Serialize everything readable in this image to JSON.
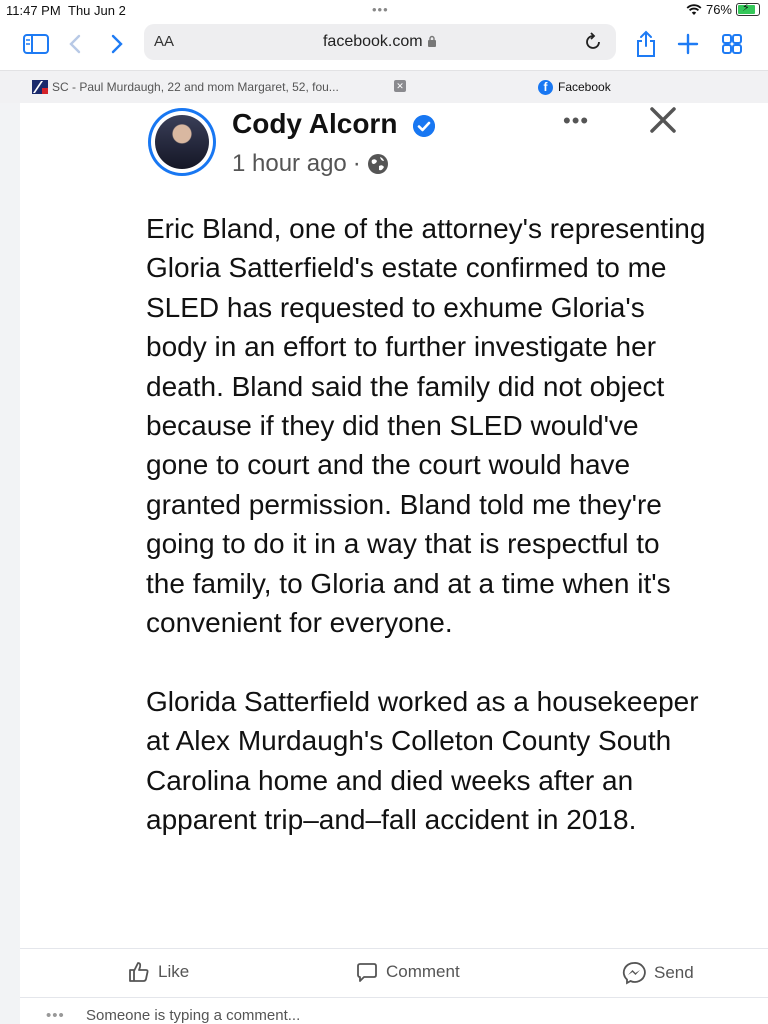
{
  "status_bar": {
    "time": "11:47 PM",
    "date": "Thu Jun 2",
    "battery": "76%",
    "battery_level": 0.76
  },
  "browser": {
    "aa_label": "AA",
    "url": "facebook.com",
    "accent": "#1e7bf4"
  },
  "tabs": [
    {
      "title": "SC - Paul Murdaugh, 22 and mom Margaret, 52, fou..."
    },
    {
      "title": "Facebook"
    }
  ],
  "post": {
    "author": "Cody Alcorn",
    "time": "1 hour ago",
    "privacy_icon": "globe-icon",
    "paragraphs": [
      "Eric Bland, one of the attorney's representing Gloria Satterfield's estate confirmed to me SLED has requested to exhume Gloria's body in an effort to further investigate her death. Bland said the family did not object because if they did then SLED would've gone to court and the court would have granted permission. Bland told me they're going to do it in a way that is respectful to the family, to Gloria and at a time when it's convenient for everyone.",
      "Glorida Satterfield worked as a housekeeper at Alex Murdaugh's Colleton County South Carolina home and died weeks after an apparent trip–and–fall accident in 2018."
    ]
  },
  "actions": {
    "like": "Like",
    "comment": "Comment",
    "send": "Send"
  },
  "typing": {
    "text": "Someone is typing a comment..."
  },
  "colors": {
    "facebook_blue": "#1877f2"
  }
}
